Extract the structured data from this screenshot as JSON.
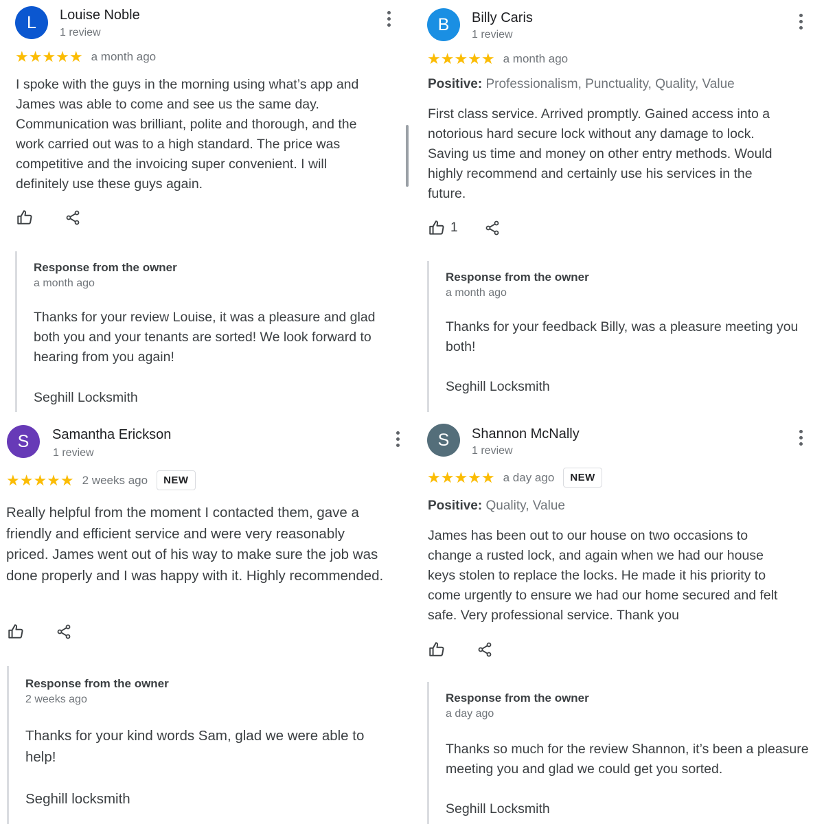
{
  "colors": {
    "star": "#fbbc04",
    "avatar_louise": "#0b57d0",
    "avatar_billy": "#1a8fe3",
    "avatar_samantha": "#673ab7",
    "avatar_shannon": "#546e7a"
  },
  "reviews": [
    {
      "initial": "L",
      "name": "Louise Noble",
      "review_count": "1 review",
      "stars": "★★★★★",
      "time": "a month ago",
      "text": "I spoke with the guys in the morning using what’s app and James was able to come and see us the same day. Communication was brilliant, polite and thorough, and the work carried out was to a high standard. The price was competitive and the invoicing super convenient. I will definitely use these guys again.",
      "owner_title": "Response from the owner",
      "owner_time": "a month ago",
      "owner_text": "Thanks for your review Louise, it was a pleasure and glad both you and your tenants are sorted! We look forward to hearing from you again!",
      "owner_sign": "Seghill Locksmith"
    },
    {
      "initial": "B",
      "name": "Billy Caris",
      "review_count": "1 review",
      "stars": "★★★★★",
      "time": "a month ago",
      "positive_label": "Positive:",
      "positive_values": "Professionalism, Punctuality, Quality, Value",
      "text": "First class service. Arrived promptly. Gained access into a notorious hard secure lock  without any damage to lock. Saving us time and money on other entry methods. Would highly recommend and certainly use his services in the future.",
      "likes": "1",
      "owner_title": "Response from the owner",
      "owner_time": "a month ago",
      "owner_text": "Thanks for your feedback Billy, was a pleasure meeting you both!",
      "owner_sign": "Seghill Locksmith"
    },
    {
      "initial": "S",
      "name": "Samantha Erickson",
      "review_count": "1 review",
      "stars": "★★★★★",
      "time": "2 weeks ago",
      "badge": "NEW",
      "text": "Really helpful from the moment I contacted them, gave a friendly and efficient service and were very reasonably priced. James went out of his way to make sure the job was done properly and I was happy with it. Highly recommended.",
      "owner_title": "Response from the owner",
      "owner_time": "2 weeks ago",
      "owner_text": "Thanks for your kind words Sam, glad we were able to help!",
      "owner_sign": "Seghill locksmith"
    },
    {
      "initial": "S",
      "name": "Shannon McNally",
      "review_count": "1 review",
      "stars": "★★★★★",
      "time": "a day ago",
      "badge": "NEW",
      "positive_label": "Positive:",
      "positive_values": "Quality, Value",
      "text": "James has been out to our house on two occasions to change a rusted lock, and again when we had our house keys stolen to replace the locks. He made it his priority to come urgently to ensure we had our home secured and felt safe. Very professional service. Thank you",
      "owner_title": "Response from the owner",
      "owner_time": "a day ago",
      "owner_text": "Thanks so much for the review Shannon, it’s been a pleasure meeting you and glad we could get you sorted.",
      "owner_sign": "Seghill Locksmith"
    }
  ]
}
